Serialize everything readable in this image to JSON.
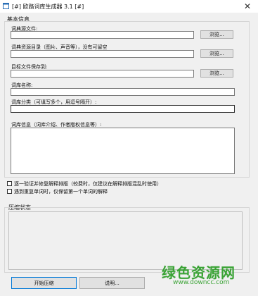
{
  "window": {
    "title": "[#] 欧路词库生成器 3.1 [#]",
    "close_glyph": "✕"
  },
  "basic_info": {
    "title": "基本信息",
    "dict_source_label": "词典源文件:",
    "dict_source_value": "",
    "resource_dir_label": "词典资源目录（图片、声音等），没有可留空",
    "resource_dir_value": "",
    "target_file_label": "目标文件保存到:",
    "target_file_value": "",
    "browse_label": "浏览...",
    "dict_name_label": "词库名称:",
    "dict_name_value": "",
    "dict_category_label": "词库分类（可填写多个，用逗号隔开）:",
    "dict_category_value": "",
    "dict_info_label": "词库信息（词库介绍、作者版权信息等）:",
    "dict_info_value": ""
  },
  "options": {
    "verify_sort_label": "逐一验证并修复解释排版（较费时，仅建议在解释排版混乱时使用）",
    "verify_sort_checked": false,
    "duplicate_word_label": "遇到重复单词时，仅保留第一个单词的解释",
    "duplicate_word_checked": false
  },
  "compress_status": {
    "title": "压缩状态",
    "value": ""
  },
  "actions": {
    "start_label": "开始压缩",
    "help_label": "说明..."
  },
  "watermark": {
    "text": "绿色资源网",
    "url": "www.downcc.com"
  },
  "colors": {
    "accent": "#0078d7",
    "watermark": "#3aa335"
  }
}
